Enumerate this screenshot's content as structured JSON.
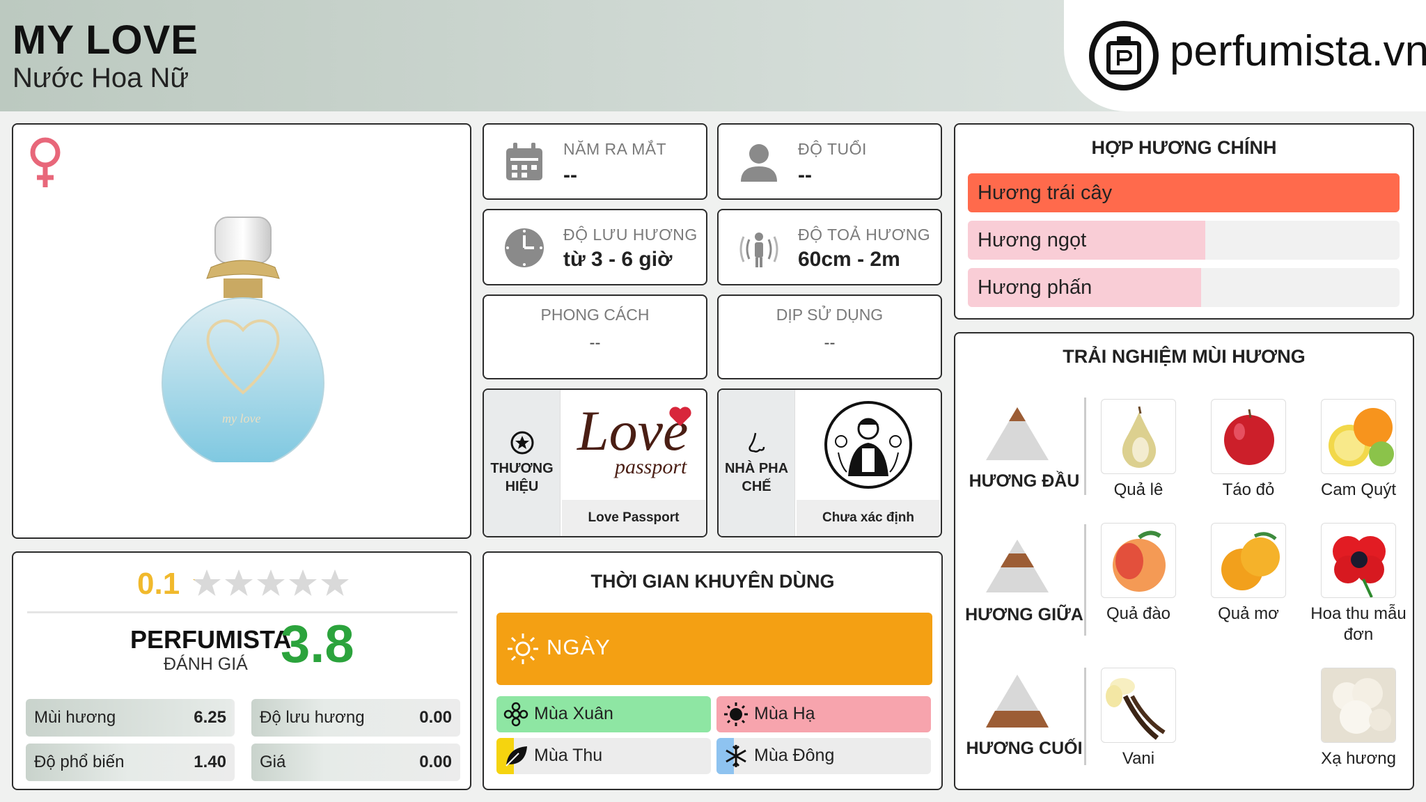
{
  "header": {
    "title": "MY LOVE",
    "subtitle": "Nước Hoa Nữ",
    "brand_site": "perfumista.vn"
  },
  "info": {
    "release_year": {
      "label": "NĂM RA MẮT",
      "value": "--"
    },
    "age": {
      "label": "ĐỘ TUỔI",
      "value": "--"
    },
    "longevity": {
      "label": "ĐỘ LƯU HƯƠNG",
      "value": "từ 3 - 6 giờ"
    },
    "sillage": {
      "label": "ĐỘ TOẢ HƯƠNG",
      "value": "60cm - 2m"
    },
    "style": {
      "label": "PHONG CÁCH",
      "value": "--"
    },
    "occasion": {
      "label": "DỊP SỬ DỤNG",
      "value": "--"
    }
  },
  "brand": {
    "label": "THƯƠNG HIỆU",
    "name": "Love Passport",
    "logo_text": "Love",
    "logo_sub": "passport"
  },
  "perfumer": {
    "label": "NHÀ PHA CHẾ",
    "name": "Chưa xác định"
  },
  "bottle_text": "my love",
  "accords": {
    "title": "HỢP HƯƠNG CHÍNH",
    "items": [
      {
        "label": "Hương trái cây",
        "level": 1.0,
        "color": "#ff6a4c"
      },
      {
        "label": "Hương ngọt",
        "level": 0.55,
        "color": "#f9cdd6"
      },
      {
        "label": "Hương phấn",
        "level": 0.54,
        "color": "#f9cdd6"
      }
    ]
  },
  "notes": {
    "title": "TRẢI NGHIỆM MÙI HƯƠNG",
    "top": {
      "label": "HƯƠNG ĐẦU",
      "items": [
        "Quả lê",
        "Táo đỏ",
        "Cam Quýt"
      ]
    },
    "middle": {
      "label": "HƯƠNG GIỮA",
      "items": [
        "Quả đào",
        "Quả mơ",
        "Hoa thu mẫu đơn"
      ]
    },
    "base": {
      "label": "HƯƠNG CUỐI",
      "items": [
        "Vani",
        "Xạ hương"
      ]
    }
  },
  "rating": {
    "user_score": "0.1",
    "stars": 0.02,
    "perfumista_label": "PERFUMISTA",
    "perfumista_sub": "ĐÁNH GIÁ",
    "perfumista_score": "3.8",
    "metrics": [
      {
        "name": "Mùi hương",
        "value": "6.25",
        "level": 0.625
      },
      {
        "name": "Độ lưu hương",
        "value": "0.00",
        "level": 0
      },
      {
        "name": "Độ phổ biến",
        "value": "1.40",
        "level": 0.14
      },
      {
        "name": "Giá",
        "value": "0.00",
        "level": 0
      }
    ]
  },
  "time": {
    "title": "THỜI GIAN KHUYÊN DÙNG",
    "day_label": "NGÀY",
    "seasons": [
      {
        "label": "Mùa Xuân",
        "color": "#8ee6a3",
        "level": 1.0
      },
      {
        "label": "Mùa Hạ",
        "color": "#f7a4ad",
        "level": 1.0
      },
      {
        "label": "Mùa Thu",
        "color": "#f5d40f",
        "level": 0.08
      },
      {
        "label": "Mùa Đông",
        "color": "#8ec3f0",
        "level": 0.08
      }
    ]
  },
  "colors": {
    "accent_green": "#2ba33c",
    "star_gold": "#f1b92c",
    "venus_pink": "#e8677a"
  }
}
